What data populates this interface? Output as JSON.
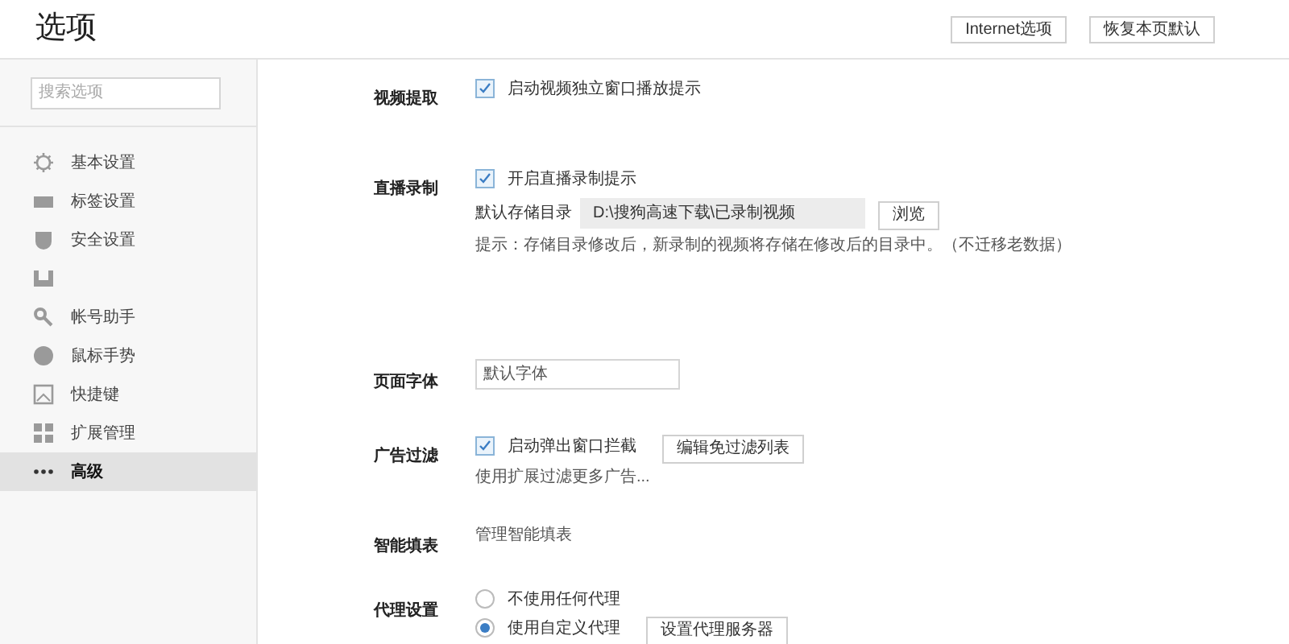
{
  "window": {
    "title": "选项"
  },
  "header_buttons": [
    "Internet选项",
    "恢复本页默认"
  ],
  "sidebar": {
    "search": {
      "placeholder": "搜索选项"
    },
    "items": [
      {
        "kind": "gear",
        "label": "基本设置",
        "selected": false
      },
      {
        "kind": "tab",
        "label": "标签设置",
        "selected": false
      },
      {
        "kind": "shield",
        "label": "安全设置",
        "selected": false
      },
      {
        "kind": "download",
        "selected": false
      },
      {
        "kind": "key",
        "label": "帐号助手",
        "selected": false
      },
      {
        "kind": "mouse",
        "label": "鼠标手势",
        "selected": false
      },
      {
        "kind": "keyboard",
        "label": "快捷键",
        "selected": false
      },
      {
        "kind": "grid",
        "label": "扩展管理",
        "selected": false
      },
      {
        "kind": "dots",
        "label": "高级",
        "selected": true
      }
    ]
  },
  "sections": [
    {
      "label": "视频提取",
      "rows": [
        {
          "kind": "checkbox",
          "label": "启动视频独立窗口播放提示",
          "checked": true
        }
      ]
    },
    {
      "label": "直播录制",
      "rows": [
        {
          "kind": "checkbox",
          "label": "开启直播录制提示",
          "checked": true
        },
        {
          "kind": "path",
          "label": "默认存储目录",
          "value": "D:\\搜狗高速下载\\已录制视频",
          "button": "浏览"
        },
        {
          "kind": "text",
          "text": "提示：存储目录修改后，新录制的视频将存储在修改后的目录中。（不迁移老数据）"
        }
      ]
    },
    {
      "rows": [
        {
          "kind": "blank"
        }
      ]
    },
    {
      "label": "页面字体",
      "rows": [
        {
          "kind": "select",
          "value": "默认字体"
        }
      ]
    },
    {
      "label": "广告过滤",
      "rows": [
        {
          "kind": "checkbox",
          "label": "启动弹出窗口拦截",
          "checked": true,
          "button": "编辑免过滤列表"
        },
        {
          "kind": "text",
          "text": "使用扩展过滤更多广告..."
        }
      ]
    },
    {
      "label": "智能填表",
      "rows": [
        {
          "kind": "text",
          "text": "管理智能填表"
        }
      ]
    },
    {
      "label": "代理设置",
      "rows": [
        {
          "kind": "radio",
          "label": "不使用任何代理",
          "selected": false
        },
        {
          "kind": "radio",
          "label": "使用自定义代理",
          "selected": true,
          "button": "设置代理服务器"
        }
      ]
    }
  ]
}
